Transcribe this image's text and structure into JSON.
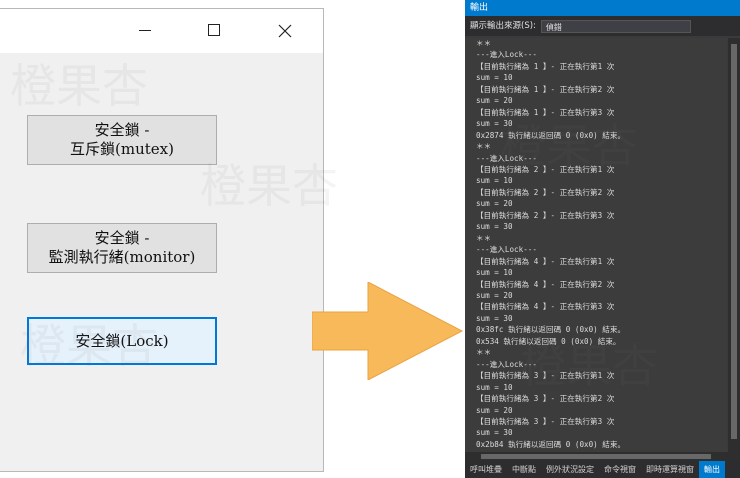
{
  "window": {
    "buttons": [
      {
        "lines": [
          "安全鎖 -",
          "互斥鎖(mutex)"
        ]
      },
      {
        "lines": [
          "安全鎖 -",
          "監測執行緒(monitor)"
        ]
      },
      {
        "lines": [
          "安全鎖(Lock)"
        ]
      }
    ]
  },
  "output_pane": {
    "title": "輸出",
    "source_label": "顯示輸出來源(S):",
    "source_value": "偵錯",
    "lines": [
      "＊＊",
      "---進入Lock---",
      "【目前執行緒為 1 】- 正在執行第1 次",
      "sum = 10",
      "【目前執行緒為 1 】- 正在執行第2 次",
      "sum = 20",
      "【目前執行緒為 1 】- 正在執行第3 次",
      "sum = 30",
      "0x2874 執行緒以返回碼 0 (0x0) 結束。",
      "＊＊",
      "---進入Lock---",
      "【目前執行緒為 2 】- 正在執行第1 次",
      "sum = 10",
      "【目前執行緒為 2 】- 正在執行第2 次",
      "sum = 20",
      "【目前執行緒為 2 】- 正在執行第3 次",
      "sum = 30",
      "＊＊",
      "---進入Lock---",
      "【目前執行緒為 4 】- 正在執行第1 次",
      "sum = 10",
      "【目前執行緒為 4 】- 正在執行第2 次",
      "sum = 20",
      "【目前執行緒為 4 】- 正在執行第3 次",
      "sum = 30",
      "0x38fc 執行緒以返回碼 0 (0x0) 結束。",
      "0x534 執行緒以返回碼 0 (0x0) 結束。",
      "＊＊",
      "---進入Lock---",
      "【目前執行緒為 3 】- 正在執行第1 次",
      "sum = 10",
      "【目前執行緒為 3 】- 正在執行第2 次",
      "sum = 20",
      "【目前執行緒為 3 】- 正在執行第3 次",
      "sum = 30",
      "0x2b84 執行緒以返回碼 0 (0x0) 結束。"
    ],
    "tabs": [
      {
        "label": "呼叫堆疊",
        "active": false
      },
      {
        "label": "中斷點",
        "active": false
      },
      {
        "label": "例外狀況設定",
        "active": false
      },
      {
        "label": "命令視窗",
        "active": false
      },
      {
        "label": "即時運算視窗",
        "active": false
      },
      {
        "label": "輸出",
        "active": true
      }
    ]
  },
  "colors": {
    "accent": "#007acc",
    "arrow_fill": "#f8b95b",
    "button_focus_border": "#0078d7"
  },
  "watermark": "橙果杏"
}
